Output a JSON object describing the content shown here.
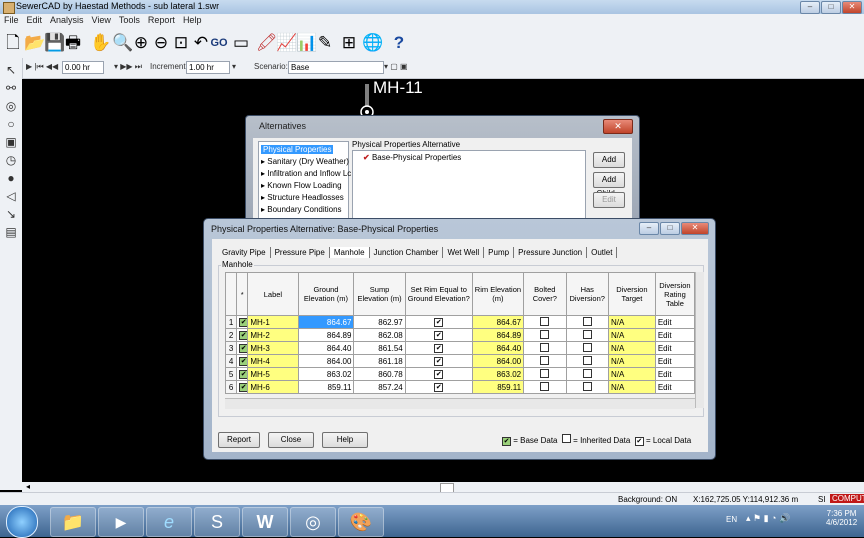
{
  "app": {
    "title": "SewerCAD by Haestad Methods - sub lateral 1.swr",
    "menu": [
      "File",
      "Edit",
      "Analysis",
      "View",
      "Tools",
      "Report",
      "Help"
    ]
  },
  "toolbar2": {
    "time_value": "0.00 hr",
    "increment_label": "Increment:",
    "increment_value": "1.00 hr",
    "scenario_label": "Scenario:",
    "scenario_value": "Base"
  },
  "toolbar1": {
    "go_label": "GO"
  },
  "canvas": {
    "node_label": "MH-11"
  },
  "alternatives": {
    "title": "Alternatives",
    "tree": [
      "Physical Properties",
      "Sanitary (Dry Weather)",
      "Infiltration and Inflow Lc",
      "Known Flow Loading",
      "Structure Headlosses",
      "Boundary Conditions"
    ],
    "group_label": "Physical Properties Alternative",
    "item": "Base-Physical Properties",
    "buttons": {
      "add": "Add",
      "add_child": "Add Child...",
      "edit": "Edit"
    }
  },
  "physical": {
    "title": "Physical Properties Alternative: Base-Physical Properties",
    "tabs": [
      "Gravity Pipe",
      "Pressure Pipe",
      "Manhole",
      "Junction Chamber",
      "Wet Well",
      "Pump",
      "Pressure Junction",
      "Outlet"
    ],
    "group_label": "Manhole",
    "columns": [
      "Label",
      "Ground Elevation (m)",
      "Sump Elevation (m)",
      "Set Rim Equal to Ground Elevation?",
      "Rim Elevation (m)",
      "Bolted Cover?",
      "Has Diversion?",
      "Diversion Target",
      "Diversion Rating Table"
    ],
    "rows": [
      {
        "n": "1",
        "label": "MH-1",
        "ground": "864.67",
        "sump": "862.97",
        "rim": "864.67",
        "target": "N/A",
        "table": "Edit"
      },
      {
        "n": "2",
        "label": "MH-2",
        "ground": "864.89",
        "sump": "862.08",
        "rim": "864.89",
        "target": "N/A",
        "table": "Edit"
      },
      {
        "n": "3",
        "label": "MH-3",
        "ground": "864.40",
        "sump": "861.54",
        "rim": "864.40",
        "target": "N/A",
        "table": "Edit"
      },
      {
        "n": "4",
        "label": "MH-4",
        "ground": "864.00",
        "sump": "861.18",
        "rim": "864.00",
        "target": "N/A",
        "table": "Edit"
      },
      {
        "n": "5",
        "label": "MH-5",
        "ground": "863.02",
        "sump": "860.78",
        "rim": "863.02",
        "target": "N/A",
        "table": "Edit"
      },
      {
        "n": "6",
        "label": "MH-6",
        "ground": "859.11",
        "sump": "857.24",
        "rim": "859.11",
        "target": "N/A",
        "table": "Edit"
      }
    ],
    "buttons": {
      "report": "Report",
      "close": "Close",
      "help": "Help"
    },
    "legend": {
      "base": "= Base Data",
      "inherited": "= Inherited Data",
      "local": "= Local Data"
    }
  },
  "status": {
    "background": "Background: ON",
    "coords": "X:162,725.05 Y:114,912.36 m",
    "units": "SI",
    "compute": "COMPUTE"
  },
  "taskbar": {
    "lang": "EN",
    "time": "7:36 PM",
    "date": "4/6/2012"
  }
}
